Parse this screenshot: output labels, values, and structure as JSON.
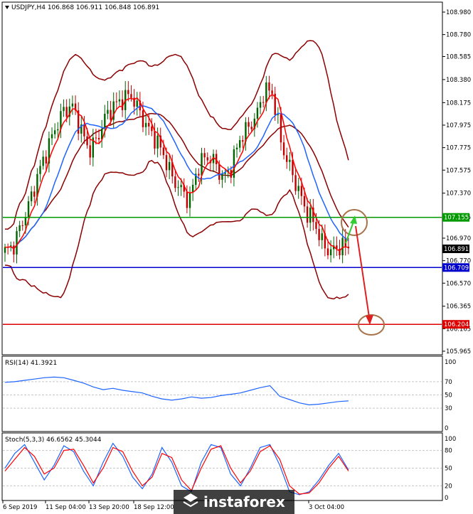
{
  "header": {
    "symbol_line": "USDJPY,H4  106.868 106.911 106.848 106.891",
    "rsi_label": "RSI(14) 41.3921",
    "stoch_label": "Stoch(5,3,3) 46.6562 45.3044"
  },
  "watermark": {
    "text": "instaforex"
  },
  "colors": {
    "support_line": "#0000cc",
    "resistance_line": "#009900",
    "target_line": "#dd0000",
    "bollinger": "#8b0000",
    "ma_fast": "#ff0000",
    "ma_slow": "#1e64ff",
    "bull_candle": "#006400",
    "bear_candle": "#c00000",
    "annotation_circle": "#a8724a",
    "arrow_up": "#33cc33",
    "arrow_down": "#e02020"
  },
  "chart_data": [
    {
      "type": "candlestick",
      "panel": "main",
      "ylim": [
        105.965,
        108.98
      ],
      "y_ticks": [
        "108.980",
        "108.780",
        "108.585",
        "108.380",
        "108.175",
        "107.975",
        "107.775",
        "107.575",
        "107.370",
        "107.155",
        "106.970",
        "106.770",
        "106.570",
        "106.365",
        "106.165",
        "105.965"
      ],
      "x_ticks": [
        "6 Sep 2019",
        "11 Sep 04:00",
        "13 Sep 20:00",
        "18 Sep 12:00",
        "3 Oct 04:00"
      ],
      "current_price": "106.891",
      "levels": [
        {
          "name": "resistance",
          "value": 107.155,
          "label": "107.155"
        },
        {
          "name": "support",
          "value": 106.709,
          "label": "106.709"
        },
        {
          "name": "target",
          "value": 106.204,
          "label": "106.204"
        }
      ],
      "price_path": [
        106.85,
        106.9,
        107.1,
        107.3,
        107.55,
        107.75,
        107.95,
        108.1,
        108.15,
        107.95,
        107.75,
        107.85,
        108.05,
        108.15,
        108.2,
        108.25,
        108.1,
        107.95,
        107.85,
        107.7,
        107.5,
        107.4,
        107.3,
        107.6,
        107.7,
        107.65,
        107.5,
        107.6,
        107.85,
        107.95,
        108.05,
        108.3,
        108.25,
        107.8,
        107.6,
        107.4,
        107.2,
        107.1,
        106.9,
        106.85,
        106.9,
        106.89
      ]
    },
    {
      "type": "line",
      "panel": "rsi",
      "title": "RSI(14) 41.3921",
      "ylim": [
        0,
        100
      ],
      "y_ticks": [
        "100",
        "70",
        "50",
        "30",
        "0"
      ],
      "series": [
        {
          "name": "RSI(14)",
          "values": [
            69,
            70,
            72,
            74,
            76,
            77,
            76,
            72,
            68,
            62,
            58,
            60,
            57,
            55,
            53,
            48,
            44,
            42,
            44,
            47,
            45,
            46,
            49,
            51,
            53,
            57,
            61,
            64,
            48,
            43,
            38,
            35,
            36,
            38,
            40,
            41
          ]
        }
      ]
    },
    {
      "type": "line",
      "panel": "stochastic",
      "title": "Stoch(5,3,3) 46.6562 45.3044",
      "ylim": [
        0,
        100
      ],
      "y_ticks": [
        "100",
        "80",
        "50",
        "20",
        "0"
      ],
      "series": [
        {
          "name": "Main",
          "values": [
            50,
            75,
            90,
            60,
            30,
            55,
            88,
            78,
            45,
            20,
            60,
            92,
            70,
            35,
            15,
            40,
            85,
            60,
            20,
            10,
            60,
            90,
            85,
            40,
            20,
            50,
            85,
            90,
            55,
            10,
            5,
            10,
            30,
            55,
            75,
            47
          ]
        },
        {
          "name": "Signal",
          "values": [
            45,
            65,
            85,
            70,
            40,
            50,
            80,
            82,
            55,
            25,
            50,
            85,
            78,
            45,
            20,
            35,
            75,
            68,
            30,
            12,
            50,
            82,
            88,
            50,
            25,
            45,
            78,
            88,
            65,
            20,
            6,
            8,
            25,
            50,
            70,
            45
          ]
        }
      ]
    }
  ]
}
